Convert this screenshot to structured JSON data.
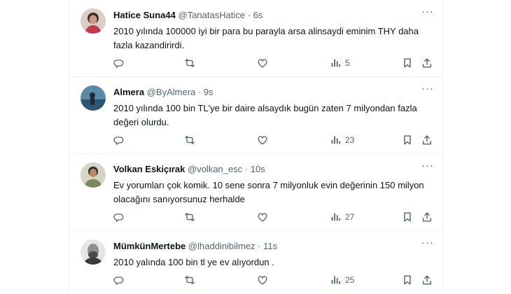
{
  "tweets": [
    {
      "name": "Hatice Suna44",
      "handle": "@TanatasHatice",
      "dot": "·",
      "time": "6s",
      "text": "2010 yılında 100000 iyi bir para bu parayla arsa alinsaydi eminim THY daha fazla kazandirirdi.",
      "views": "5"
    },
    {
      "name": "Almera",
      "handle": "@ByAlmera",
      "dot": "·",
      "time": "9s",
      "text": "2010 yılında 100 bin TL'ye bir daire alsaydık bugün zaten 7 milyondan fazla değeri olurdu.",
      "views": "23"
    },
    {
      "name": "Volkan Eskiçırak",
      "handle": "@volkan_esc",
      "dot": "·",
      "time": "10s",
      "text": "Ev yorumları çok komik. 10 sene sonra 7 milyonluk evin değerinin 150 milyon olacağını sanıyorsunuz herhalde",
      "views": "27"
    },
    {
      "name": "MümkünMertebe",
      "handle": "@lhaddinibilmez",
      "dot": "·",
      "time": "11s",
      "text": "2010 yalında 100 bin tl ye ev alıyordun .",
      "views": "25"
    }
  ],
  "more_glyph": "···",
  "icons": {
    "reply": "reply-icon",
    "retweet": "retweet-icon",
    "like": "like-icon",
    "views": "views-icon",
    "bookmark": "bookmark-icon",
    "share": "share-icon"
  },
  "colors": {
    "text": "#0f1419",
    "secondary": "#536471",
    "border": "#eff3f4"
  }
}
